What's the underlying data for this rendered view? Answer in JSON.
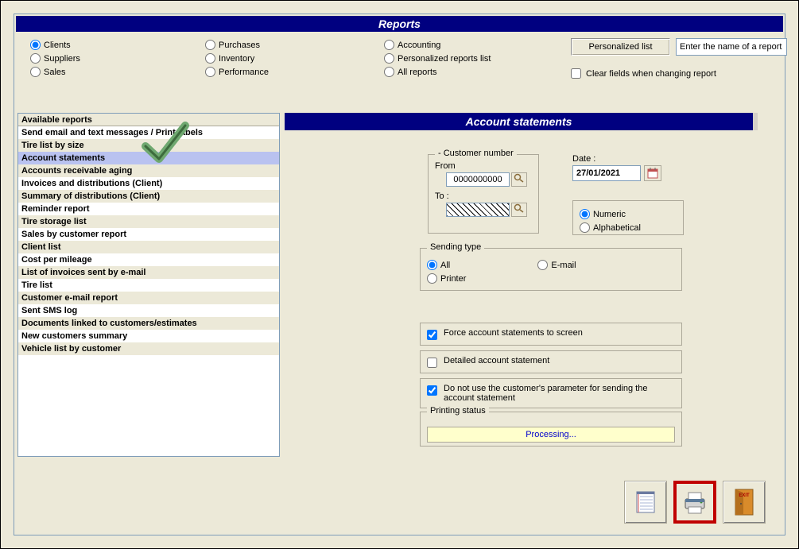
{
  "title": "Reports",
  "categories": {
    "col1": [
      {
        "label": "Clients",
        "checked": true
      },
      {
        "label": "Suppliers",
        "checked": false
      },
      {
        "label": "Sales",
        "checked": false
      }
    ],
    "col2": [
      {
        "label": "Purchases",
        "checked": false
      },
      {
        "label": "Inventory",
        "checked": false
      },
      {
        "label": "Performance",
        "checked": false
      }
    ],
    "col3": [
      {
        "label": "Accounting",
        "checked": false
      },
      {
        "label": "Personalized reports list",
        "checked": false
      },
      {
        "label": "All reports",
        "checked": false
      }
    ]
  },
  "personalized_button": "Personalized list",
  "search_placeholder": "Enter the name of a report",
  "clear_fields_label": "Clear fields when changing report",
  "clear_fields_checked": false,
  "available": {
    "header": "Available reports",
    "items": [
      "Send email and text messages / Print labels",
      "Tire list by size",
      "Account statements",
      "Accounts receivable aging",
      "Invoices and distributions (Client)",
      "Summary of distributions (Client)",
      "Reminder report",
      "Tire storage list",
      "Sales by customer report",
      "Client list",
      "Cost per mileage",
      "List of invoices sent by e-mail",
      "Tire list",
      "Customer e-mail report",
      "Sent SMS log",
      "Documents linked to customers/estimates",
      "New customers summary",
      "Vehicle list by customer"
    ],
    "selected_index": 2
  },
  "detail": {
    "title": "Account statements",
    "customer": {
      "legend": "- Customer number",
      "from_label": "From",
      "from_value": "0000000000",
      "to_label": "To :"
    },
    "date": {
      "label": "Date :",
      "value": "27/01/2021"
    },
    "sort": {
      "numeric": "Numeric",
      "alphabetical": "Alphabetical",
      "selected": "numeric"
    },
    "sending": {
      "legend": "Sending type",
      "all": "All",
      "printer": "Printer",
      "email": "E-mail",
      "selected": "all"
    },
    "opts": {
      "force": {
        "label": "Force account statements to screen",
        "checked": true
      },
      "detailed": {
        "label": "Detailed account statement",
        "checked": false
      },
      "nouse": {
        "label": "Do not use the customer's parameter for sending the account statement",
        "checked": true
      }
    },
    "printing": {
      "legend": "Printing status",
      "status": "Processing..."
    }
  },
  "buttons": {
    "notes": "notes",
    "print": "print",
    "exit": "EXIT"
  }
}
